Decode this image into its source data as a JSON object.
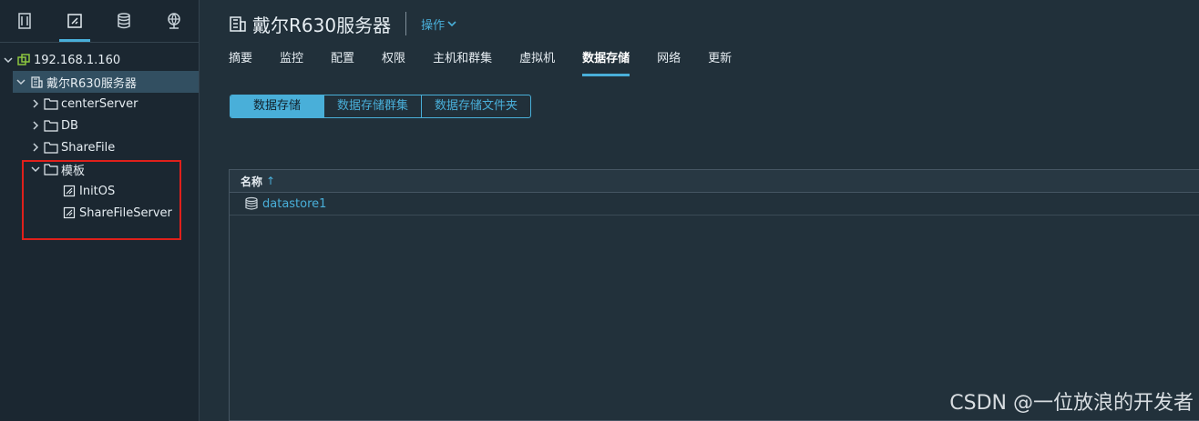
{
  "sidebar": {
    "tabs": [
      {
        "icon": "hosts-clusters-icon"
      },
      {
        "icon": "vms-templates-icon",
        "active": true
      },
      {
        "icon": "storage-icon"
      },
      {
        "icon": "networking-icon"
      }
    ],
    "tree": [
      {
        "label": "192.168.1.160",
        "level": 0,
        "expanded": true,
        "icon": "vcenter-icon"
      },
      {
        "label": "戴尔R630服务器",
        "level": 1,
        "expanded": true,
        "icon": "datacenter-icon",
        "selected": true
      },
      {
        "label": "centerServer",
        "level": 2,
        "expanded": false,
        "icon": "folder-icon"
      },
      {
        "label": "DB",
        "level": 2,
        "expanded": false,
        "icon": "folder-icon"
      },
      {
        "label": "ShareFile",
        "level": 2,
        "expanded": false,
        "icon": "folder-icon"
      },
      {
        "label": "模板",
        "level": 2,
        "expanded": true,
        "icon": "folder-icon"
      },
      {
        "label": "InitOS",
        "level": 3,
        "icon": "template-icon"
      },
      {
        "label": "ShareFileServer",
        "level": 3,
        "icon": "template-icon"
      }
    ]
  },
  "header": {
    "title": "戴尔R630服务器",
    "actions_label": "操作"
  },
  "nav_tabs": [
    {
      "label": "摘要"
    },
    {
      "label": "监控"
    },
    {
      "label": "配置"
    },
    {
      "label": "权限"
    },
    {
      "label": "主机和群集"
    },
    {
      "label": "虚拟机"
    },
    {
      "label": "数据存储",
      "active": true
    },
    {
      "label": "网络"
    },
    {
      "label": "更新"
    }
  ],
  "segments": [
    {
      "label": "数据存储",
      "active": true
    },
    {
      "label": "数据存储群集"
    },
    {
      "label": "数据存储文件夹"
    }
  ],
  "grid": {
    "column_name": "名称",
    "sort_arrow": "↑",
    "rows": [
      {
        "name": "datastore1",
        "icon": "datastore-icon"
      }
    ]
  },
  "watermark": "CSDN @一位放浪的开发者",
  "colors": {
    "accent": "#49afd9",
    "highlight": "#e0201b"
  }
}
